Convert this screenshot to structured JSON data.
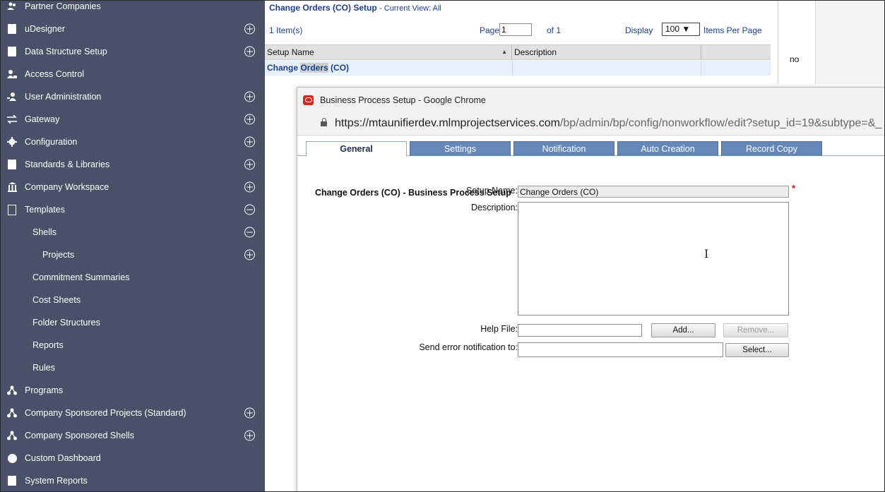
{
  "sidebar": {
    "items": [
      {
        "label": "Partner Companies",
        "icon": "people-icon",
        "toggle": "none"
      },
      {
        "label": "uDesigner",
        "icon": "document-icon",
        "toggle": "plus"
      },
      {
        "label": "Data Structure Setup",
        "icon": "document-icon",
        "toggle": "plus"
      },
      {
        "label": "Access Control",
        "icon": "users-icon",
        "toggle": "none"
      },
      {
        "label": "User Administration",
        "icon": "user-admin-icon",
        "toggle": "plus"
      },
      {
        "label": "Gateway",
        "icon": "exchange-arrows-icon",
        "toggle": "plus"
      },
      {
        "label": "Configuration",
        "icon": "gear-icon",
        "toggle": "plus"
      },
      {
        "label": "Standards & Libraries",
        "icon": "book-icon",
        "toggle": "plus"
      },
      {
        "label": "Company Workspace",
        "icon": "building-icon",
        "toggle": "plus"
      },
      {
        "label": "Templates",
        "icon": "blank-document-icon",
        "toggle": "minus"
      },
      {
        "label": "Shells",
        "icon": "",
        "toggle": "minus"
      },
      {
        "label": "Projects",
        "icon": "",
        "toggle": "plus"
      },
      {
        "label": "Commitment Summaries",
        "icon": "",
        "toggle": "none"
      },
      {
        "label": "Cost Sheets",
        "icon": "",
        "toggle": "none"
      },
      {
        "label": "Folder Structures",
        "icon": "",
        "toggle": "none"
      },
      {
        "label": "Reports",
        "icon": "",
        "toggle": "none"
      },
      {
        "label": "Rules",
        "icon": "",
        "toggle": "none"
      },
      {
        "label": "Programs",
        "icon": "hierarchy-icon",
        "toggle": "none"
      },
      {
        "label": "Company Sponsored Projects (Standard)",
        "icon": "hierarchy-icon",
        "toggle": "plus"
      },
      {
        "label": "Company Sponsored Shells",
        "icon": "hierarchy-icon",
        "toggle": "plus"
      },
      {
        "label": "Custom Dashboard",
        "icon": "pie-icon",
        "toggle": "none"
      },
      {
        "label": "System Reports",
        "icon": "report-icon",
        "toggle": "none"
      }
    ]
  },
  "list_panel": {
    "title": "Change Orders (CO) Setup",
    "view_label": "- Current View: All",
    "item_count": "1 Item(s)",
    "page_label": "Page",
    "page_value": "1",
    "of_label": "of 1",
    "display_label": "Display",
    "display_value": "100 ▼",
    "per_page_label": "Items Per Page",
    "columns": [
      "Setup Name",
      "Description"
    ],
    "sort_indicator": "▲",
    "rows": [
      {
        "name_pre": "Change ",
        "name_highlight": "Orders",
        "name_post": " (CO)",
        "description": ""
      }
    ],
    "clipped_text": "no"
  },
  "popup": {
    "window_title": "Business Process Setup - Google Chrome",
    "url_host": "https://mtaunifierdev.mlmprojectservices.com",
    "url_path": "/bp/admin/bp/config/nonworkflow/edit?setup_id=19&subtype=&_",
    "tabs": [
      "General",
      "Settings",
      "Notification",
      "Auto Creation",
      "Record Copy"
    ],
    "active_tab": "General",
    "heading": "Change Orders (CO) - Business Process Setup",
    "form": {
      "setup_name_label": "Setup Name:",
      "setup_name_value": "Change Orders (CO)",
      "required_mark": "*",
      "description_label": "Description:",
      "description_value": "",
      "help_file_label": "Help File:",
      "help_file_value": "",
      "add_button": "Add...",
      "remove_button": "Remove...",
      "send_error_label": "Send error notification to:",
      "send_error_value": "",
      "select_button": "Select..."
    }
  },
  "colors": {
    "sidebar_bg": "#4a5068",
    "link_blue": "#1b3f8f",
    "tab_blue": "#6588b8",
    "required_red": "#d01010"
  }
}
